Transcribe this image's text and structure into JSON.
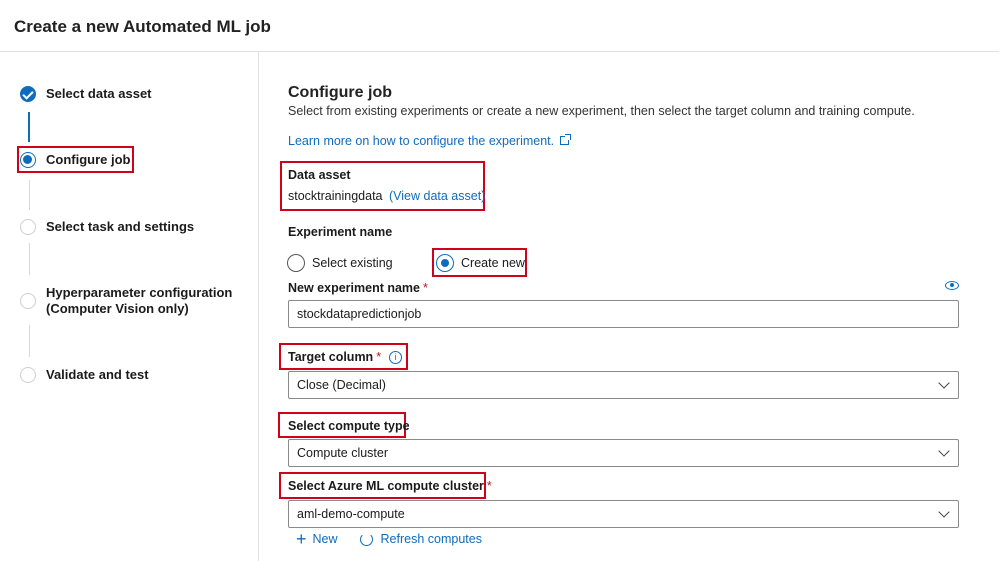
{
  "header": {
    "title": "Create a new Automated ML job"
  },
  "steps": [
    {
      "label": "Select data asset",
      "status": "done"
    },
    {
      "label": "Configure job",
      "status": "current"
    },
    {
      "label": "Select task and settings",
      "status": "todo"
    },
    {
      "label": "Hyperparameter configuration",
      "label2": "(Computer Vision only)",
      "status": "todo"
    },
    {
      "label": "Validate and test",
      "status": "todo"
    }
  ],
  "main": {
    "title": "Configure job",
    "description": "Select from existing experiments or create a new experiment, then select the target column and training compute.",
    "learn_link": "Learn more on how to configure the experiment.",
    "data_asset": {
      "label": "Data asset",
      "value": "stocktrainingdata",
      "view_link": "(View data asset)"
    },
    "experiment": {
      "label": "Experiment name",
      "option_existing": "Select existing",
      "option_new": "Create new",
      "selected": "Create new"
    },
    "new_experiment": {
      "label": "New experiment name",
      "required": "*",
      "value": "stockdatapredictionjob"
    },
    "target_column": {
      "label": "Target column",
      "required": "*",
      "value": "Close (Decimal)"
    },
    "compute_type": {
      "label": "Select compute type",
      "value": "Compute cluster"
    },
    "compute_cluster": {
      "label": "Select Azure ML compute cluster",
      "required": "*",
      "value": "aml-demo-compute"
    },
    "actions": {
      "new": "New",
      "refresh": "Refresh computes"
    }
  },
  "colors": {
    "accent": "#0f6cbd",
    "highlight": "#d0021b",
    "required": "#c50f1f"
  },
  "icons": [
    "check-icon",
    "info-icon",
    "eye-icon",
    "chevron-down-icon",
    "plus-icon",
    "refresh-icon",
    "external-link-icon"
  ]
}
